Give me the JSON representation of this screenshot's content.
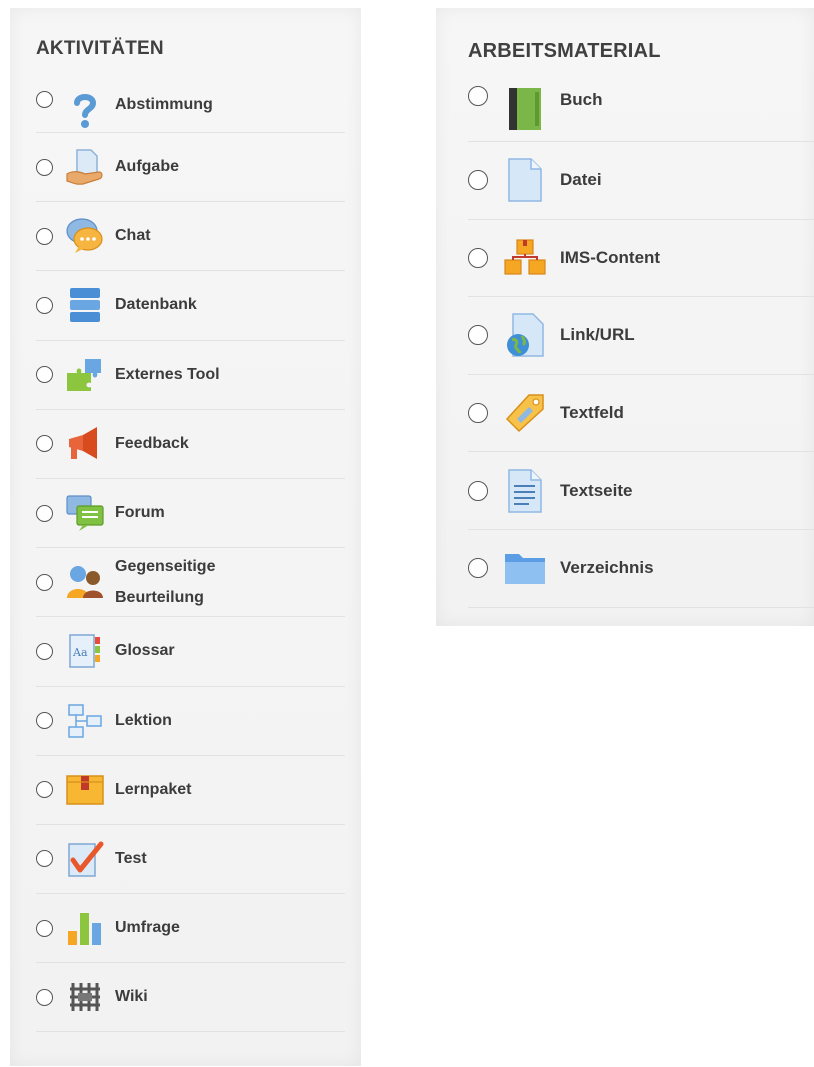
{
  "activities": {
    "heading": "AKTIVITÄTEN",
    "items": [
      {
        "label": "Abstimmung",
        "icon": "question-mark-icon"
      },
      {
        "label": "Aufgabe",
        "icon": "assignment-hand-icon"
      },
      {
        "label": "Chat",
        "icon": "chat-bubbles-icon"
      },
      {
        "label": "Datenbank",
        "icon": "database-icon"
      },
      {
        "label": "Externes Tool",
        "icon": "puzzle-icon"
      },
      {
        "label": "Feedback",
        "icon": "megaphone-icon"
      },
      {
        "label": "Forum",
        "icon": "forum-icon"
      },
      {
        "label": "Gegenseitige Beurteilung",
        "icon": "workshop-people-icon"
      },
      {
        "label": "Glossar",
        "icon": "glossary-icon"
      },
      {
        "label": "Lektion",
        "icon": "lesson-flow-icon"
      },
      {
        "label": "Lernpaket",
        "icon": "package-box-icon"
      },
      {
        "label": "Test",
        "icon": "quiz-check-icon"
      },
      {
        "label": "Umfrage",
        "icon": "bar-chart-icon"
      },
      {
        "label": "Wiki",
        "icon": "wiki-icon"
      }
    ]
  },
  "resources": {
    "heading": "ARBEITSMATERIAL",
    "items": [
      {
        "label": "Buch",
        "icon": "book-icon"
      },
      {
        "label": "Datei",
        "icon": "file-icon"
      },
      {
        "label": "IMS-Content",
        "icon": "ims-boxes-icon"
      },
      {
        "label": "Link/URL",
        "icon": "url-globe-icon"
      },
      {
        "label": "Textfeld",
        "icon": "label-tag-icon"
      },
      {
        "label": "Textseite",
        "icon": "page-icon"
      },
      {
        "label": "Verzeichnis",
        "icon": "folder-icon"
      }
    ]
  },
  "colors": {
    "panel_bg": "#f4f4f4",
    "text": "#3c3c3c",
    "divider": "#e2e2e2"
  }
}
